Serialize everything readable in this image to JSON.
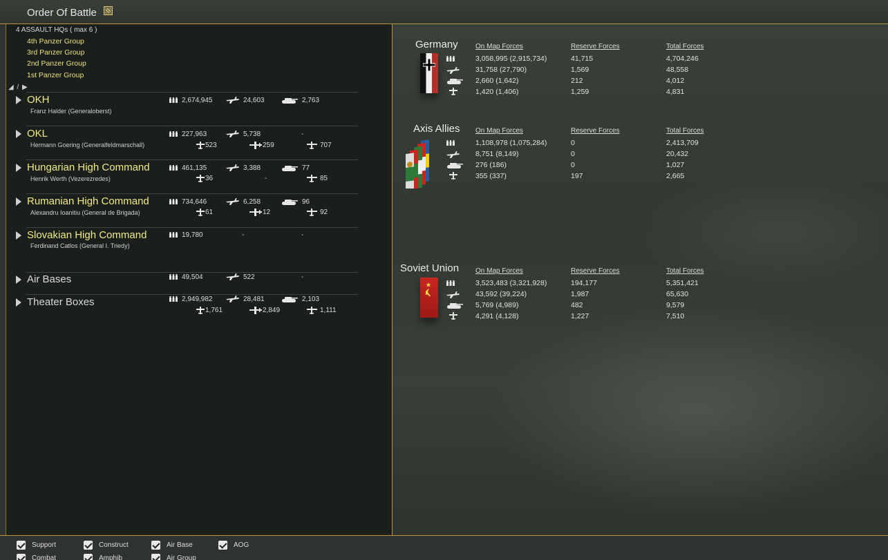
{
  "window": {
    "title": "Order Of Battle",
    "title_icon": "note-icon"
  },
  "left": {
    "hq_count": "4 ASSAULT HQs ( max 6 )",
    "hq_links": [
      "4th Panzer Group",
      "3rd Panzer Group",
      "2nd Panzer Group",
      "1st Panzer Group"
    ],
    "nav": "◢ / ▶",
    "commands": [
      {
        "name": "OKH",
        "sub": "Franz Halder  (Generaloberst)",
        "men": "2,674,945",
        "planes": "24,603",
        "tanks": "2,763"
      },
      {
        "name": "OKL",
        "sub": "Hermann Goering  (Generalfeldmarschall)",
        "men": "227,963",
        "planes": "5,738",
        "tanks": "-",
        "fighters": "523",
        "bombers": "259",
        "other": "707"
      },
      {
        "name": "Hungarian High Command",
        "sub": "Henrik Werth  (Vezerezredes)",
        "men": "461,135",
        "planes": "3,388",
        "tanks": "77",
        "fighters": "36",
        "bombers": "-",
        "other": "85"
      },
      {
        "name": "Rumanian High Command",
        "sub": "Alexandru Ioanitiu  (General de Brigada)",
        "men": "734,646",
        "planes": "6,258",
        "tanks": "96",
        "fighters": "61",
        "bombers": "12",
        "other": "92"
      },
      {
        "name": "Slovakian High Command",
        "sub": "Ferdinand Catlos  (General I. Triedy)",
        "men": "19,780",
        "planes": "-",
        "tanks": "-"
      },
      {
        "name": "Air Bases",
        "men": "49,504",
        "planes": "522",
        "tanks": "-"
      },
      {
        "name": "Theater Boxes",
        "men": "2,949,982",
        "planes": "28,481",
        "tanks": "2,103",
        "fighters": "1,761",
        "bombers": "2,849",
        "other": "1,111"
      }
    ]
  },
  "right": {
    "headers": {
      "on_map": "On Map Forces",
      "reserve": "Reserve Forces",
      "total": "Total Forces"
    },
    "factions": [
      {
        "name": "Germany",
        "on_map": [
          "3,058,995 (2,915,734)",
          "31,758 (27,790)",
          "2,660 (1,642)",
          "1,420 (1,406)"
        ],
        "reserve": [
          "41,715",
          "1,569",
          "212",
          "1,259"
        ],
        "total": [
          "4,704,246",
          "48,558",
          "4,012",
          "4,831"
        ]
      },
      {
        "name": "Axis Allies",
        "on_map": [
          "1,108,978 (1,075,284)",
          "8,751 (8,149)",
          "276 (186)",
          "355 (337)"
        ],
        "reserve": [
          "0",
          "0",
          "0",
          "197"
        ],
        "total": [
          "2,413,709",
          "20,432",
          "1,027",
          "2,665"
        ]
      },
      {
        "name": "Soviet Union",
        "on_map": [
          "3,523,483 (3,321,928)",
          "43,592 (39,224)",
          "5,769 (4,989)",
          "4,291 (4,128)"
        ],
        "reserve": [
          "194,177",
          "1,987",
          "482",
          "1,227"
        ],
        "total": [
          "5,351,421",
          "65,630",
          "9,579",
          "7,510"
        ]
      }
    ]
  },
  "filters": [
    {
      "label": "Support",
      "checked": true
    },
    {
      "label": "Construct",
      "checked": true
    },
    {
      "label": "Air Base",
      "checked": true
    },
    {
      "label": "AOG",
      "checked": true
    },
    {
      "label": "Combat",
      "checked": true
    },
    {
      "label": "Amphib",
      "checked": true
    },
    {
      "label": "Air Group",
      "checked": true
    }
  ],
  "colors": {
    "accent_gold": "#b9953e",
    "command_yellow": "#f1ea86",
    "hq_link": "#e8e27a"
  }
}
